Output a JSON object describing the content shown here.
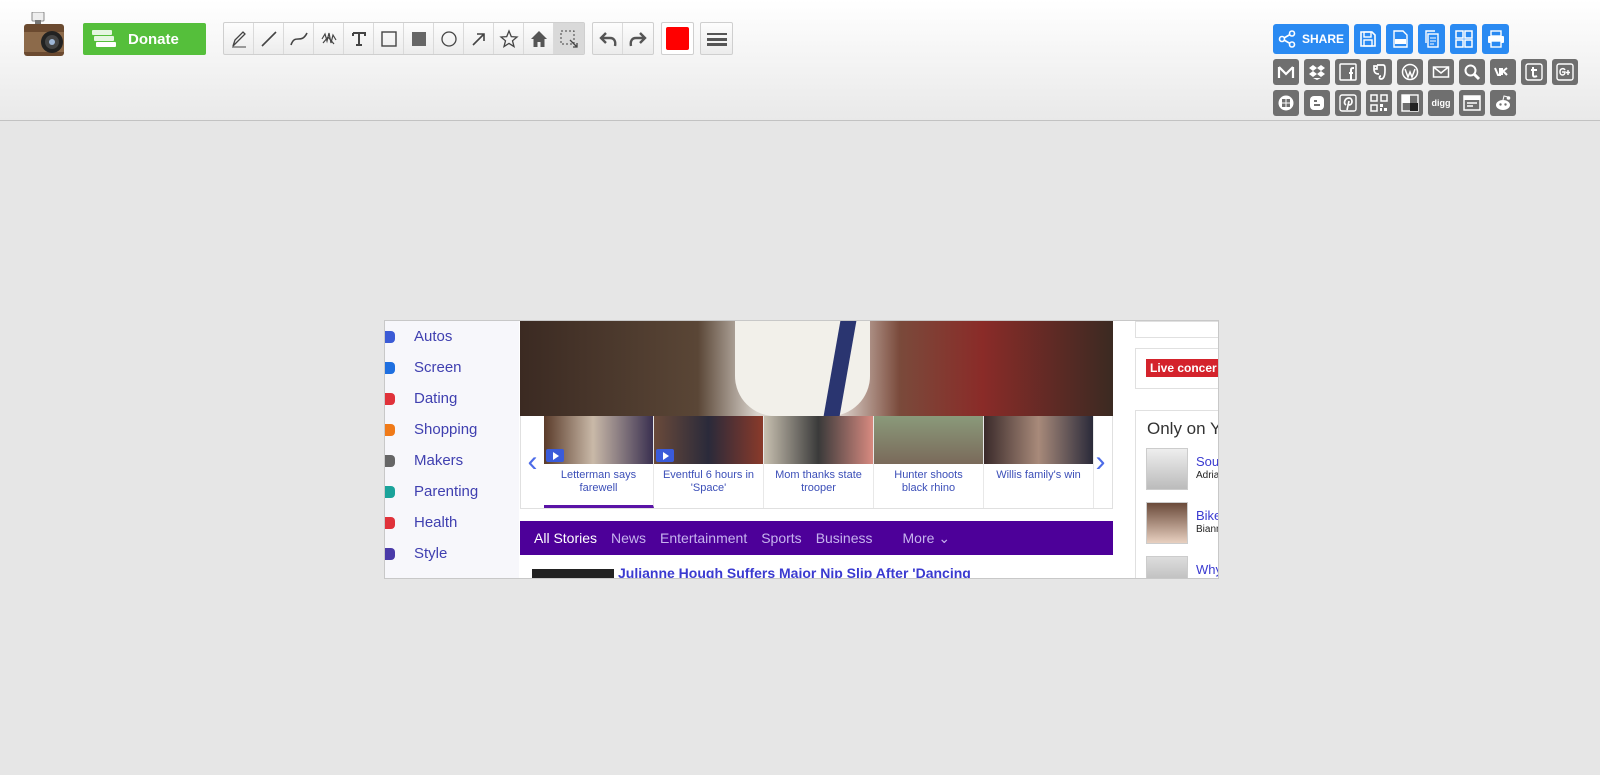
{
  "toolbar": {
    "donate_label": "Donate",
    "color": "#ff0000",
    "tools": [
      "pencil-icon",
      "line-icon",
      "curve-icon",
      "blur-icon",
      "text-icon",
      "rectangle-outline-icon",
      "rectangle-filled-icon",
      "circle-icon",
      "arrow-icon",
      "star-icon",
      "home-icon",
      "crop-select-icon"
    ],
    "history": [
      "undo-icon",
      "redo-icon"
    ]
  },
  "share": {
    "share_label": "SHARE",
    "top_row": [
      "save-icon",
      "pdf-icon",
      "copy-icon",
      "grid-icon",
      "print-icon"
    ],
    "row2": [
      "gmail-icon",
      "dropbox-icon",
      "facebook-icon",
      "evernote-icon",
      "wordpress-icon",
      "email-icon",
      "search-icon",
      "vk-icon",
      "tumblr-icon",
      "googleplus-icon"
    ],
    "row3": [
      "windows-icon",
      "blogger-icon",
      "pinterest-icon",
      "qrcode-icon",
      "delicious-icon",
      "digg-icon",
      "news-icon",
      "reddit-icon"
    ],
    "digg_label": "digg"
  },
  "page": {
    "nav": [
      {
        "label": "Autos",
        "color": "#3b5bd6"
      },
      {
        "label": "Screen",
        "color": "#1e6fe0"
      },
      {
        "label": "Dating",
        "color": "#e0323a"
      },
      {
        "label": "Shopping",
        "color": "#f07a18"
      },
      {
        "label": "Makers",
        "color": "#666666"
      },
      {
        "label": "Parenting",
        "color": "#1aa39a"
      },
      {
        "label": "Health",
        "color": "#e0323a"
      },
      {
        "label": "Style",
        "color": "#4a3aa8"
      }
    ],
    "carousel": [
      {
        "caption": "Letterman says farewell"
      },
      {
        "caption": "Eventful 6 hours in 'Space'"
      },
      {
        "caption": "Mom thanks state trooper"
      },
      {
        "caption": "Hunter shoots black rhino"
      },
      {
        "caption": "Willis family's win"
      }
    ],
    "stories_tabs": [
      "All Stories",
      "News",
      "Entertainment",
      "Sports",
      "Business"
    ],
    "more_label": "More",
    "headline": "Julianne Hough Suffers Major Nip Slip After 'Dancing",
    "live_badge": "Live concer",
    "only_title": "Only on Y",
    "people": [
      {
        "t1": "Sou",
        "t2": "Adria"
      },
      {
        "t1": "Bike",
        "t2": "Biann"
      },
      {
        "t1": "Why",
        "t2": ""
      }
    ]
  }
}
